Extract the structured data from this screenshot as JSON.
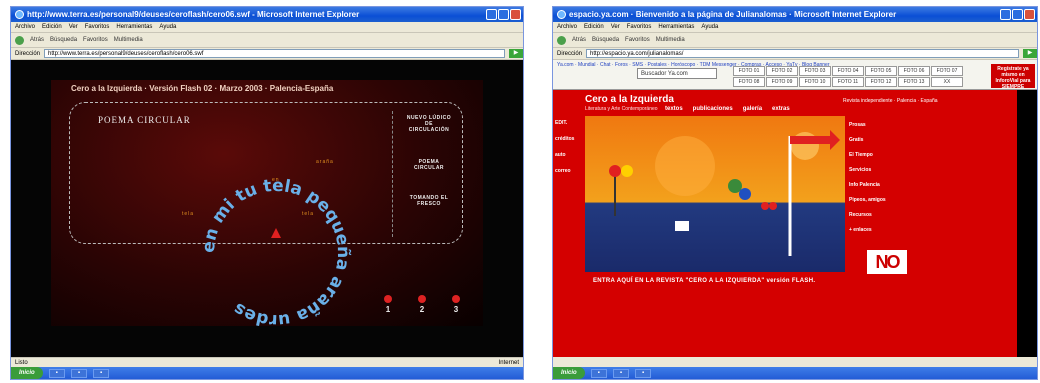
{
  "left": {
    "title": "http://www.terra.es/personal9/deuses/ceroflash/cero06.swf - Microsoft Internet Explorer",
    "menu": [
      "Archivo",
      "Edición",
      "Ver",
      "Favoritos",
      "Herramientas",
      "Ayuda"
    ],
    "toolbar": [
      "Atrás",
      "Búsqueda",
      "Favoritos",
      "Multimedia"
    ],
    "address_label": "Dirección",
    "address": "http://www.terra.es/personal9/deuses/ceroflash/cero06.swf",
    "flash_header": "Cero a la Izquierda · Versión Flash 02 · Marzo 2003 · Palencia-España",
    "poem_title": "POEMA CIRCULAR",
    "circle_text": "en mi tu tela pequeña araña urdes",
    "nav": [
      "NUEVO LÚDICO DE CIRCULACIÓN",
      "POEMA CIRCULAR",
      "TOMANDO EL FRESCO"
    ],
    "small_words": [
      "araña",
      "tela",
      "tela",
      "en"
    ],
    "pages": [
      "1",
      "2",
      "3"
    ],
    "status_left": "Listo",
    "status_right": "Internet",
    "start": "Inicio"
  },
  "right": {
    "title": "espacio.ya.com · Bienvenido a la página de Julianalomas · Microsoft Internet Explorer",
    "menu": [
      "Archivo",
      "Edición",
      "Ver",
      "Favoritos",
      "Herramientas",
      "Ayuda"
    ],
    "toolbar": [
      "Atrás",
      "Búsqueda",
      "Favoritos",
      "Multimedia"
    ],
    "address_label": "Dirección",
    "address": "http://espacio.ya.com/julianalomas/",
    "linkbar": "Ya.com · Mundial · Chat · Foros · SMS · Postales · Horóscopo · TDM Messenger · Compras · Acceso · YaTv · Blog Banner",
    "search": "Buscador Ya.com",
    "fotos": [
      "FOTO 01",
      "FOTO 02",
      "FOTO 03",
      "FOTO 04",
      "FOTO 05",
      "FOTO 06",
      "FOTO 07",
      "FOTO 08",
      "FOTO 09",
      "FOTO 10",
      "FOTO 11",
      "FOTO 12",
      "FOTO 13",
      "XX"
    ],
    "register": "Regístrate ya mismo en InforoVial para SIEMPRE",
    "cero_title": "Cero a la Izquierda",
    "subtitle": "Literatura y Arte Contemporáneo",
    "right_note": "Revista independiente · Palencia · España",
    "nav": [
      "textos",
      "publicaciones",
      "galería",
      "extras"
    ],
    "left_menu": [
      "EDIT.",
      "créditos",
      "auto",
      "correo"
    ],
    "sections": [
      "Prosas",
      "Gratis",
      "El Tiempo",
      "Servicios",
      "Info Palencia",
      "Pipeos, amigos",
      "Recursos",
      "+ enlaces"
    ],
    "logo": "NO",
    "entra": "ENTRA AQUÍ EN LA REVISTA \"CERO A LA IZQUIERDA\" versión FLASH.",
    "start": "Inicio"
  }
}
